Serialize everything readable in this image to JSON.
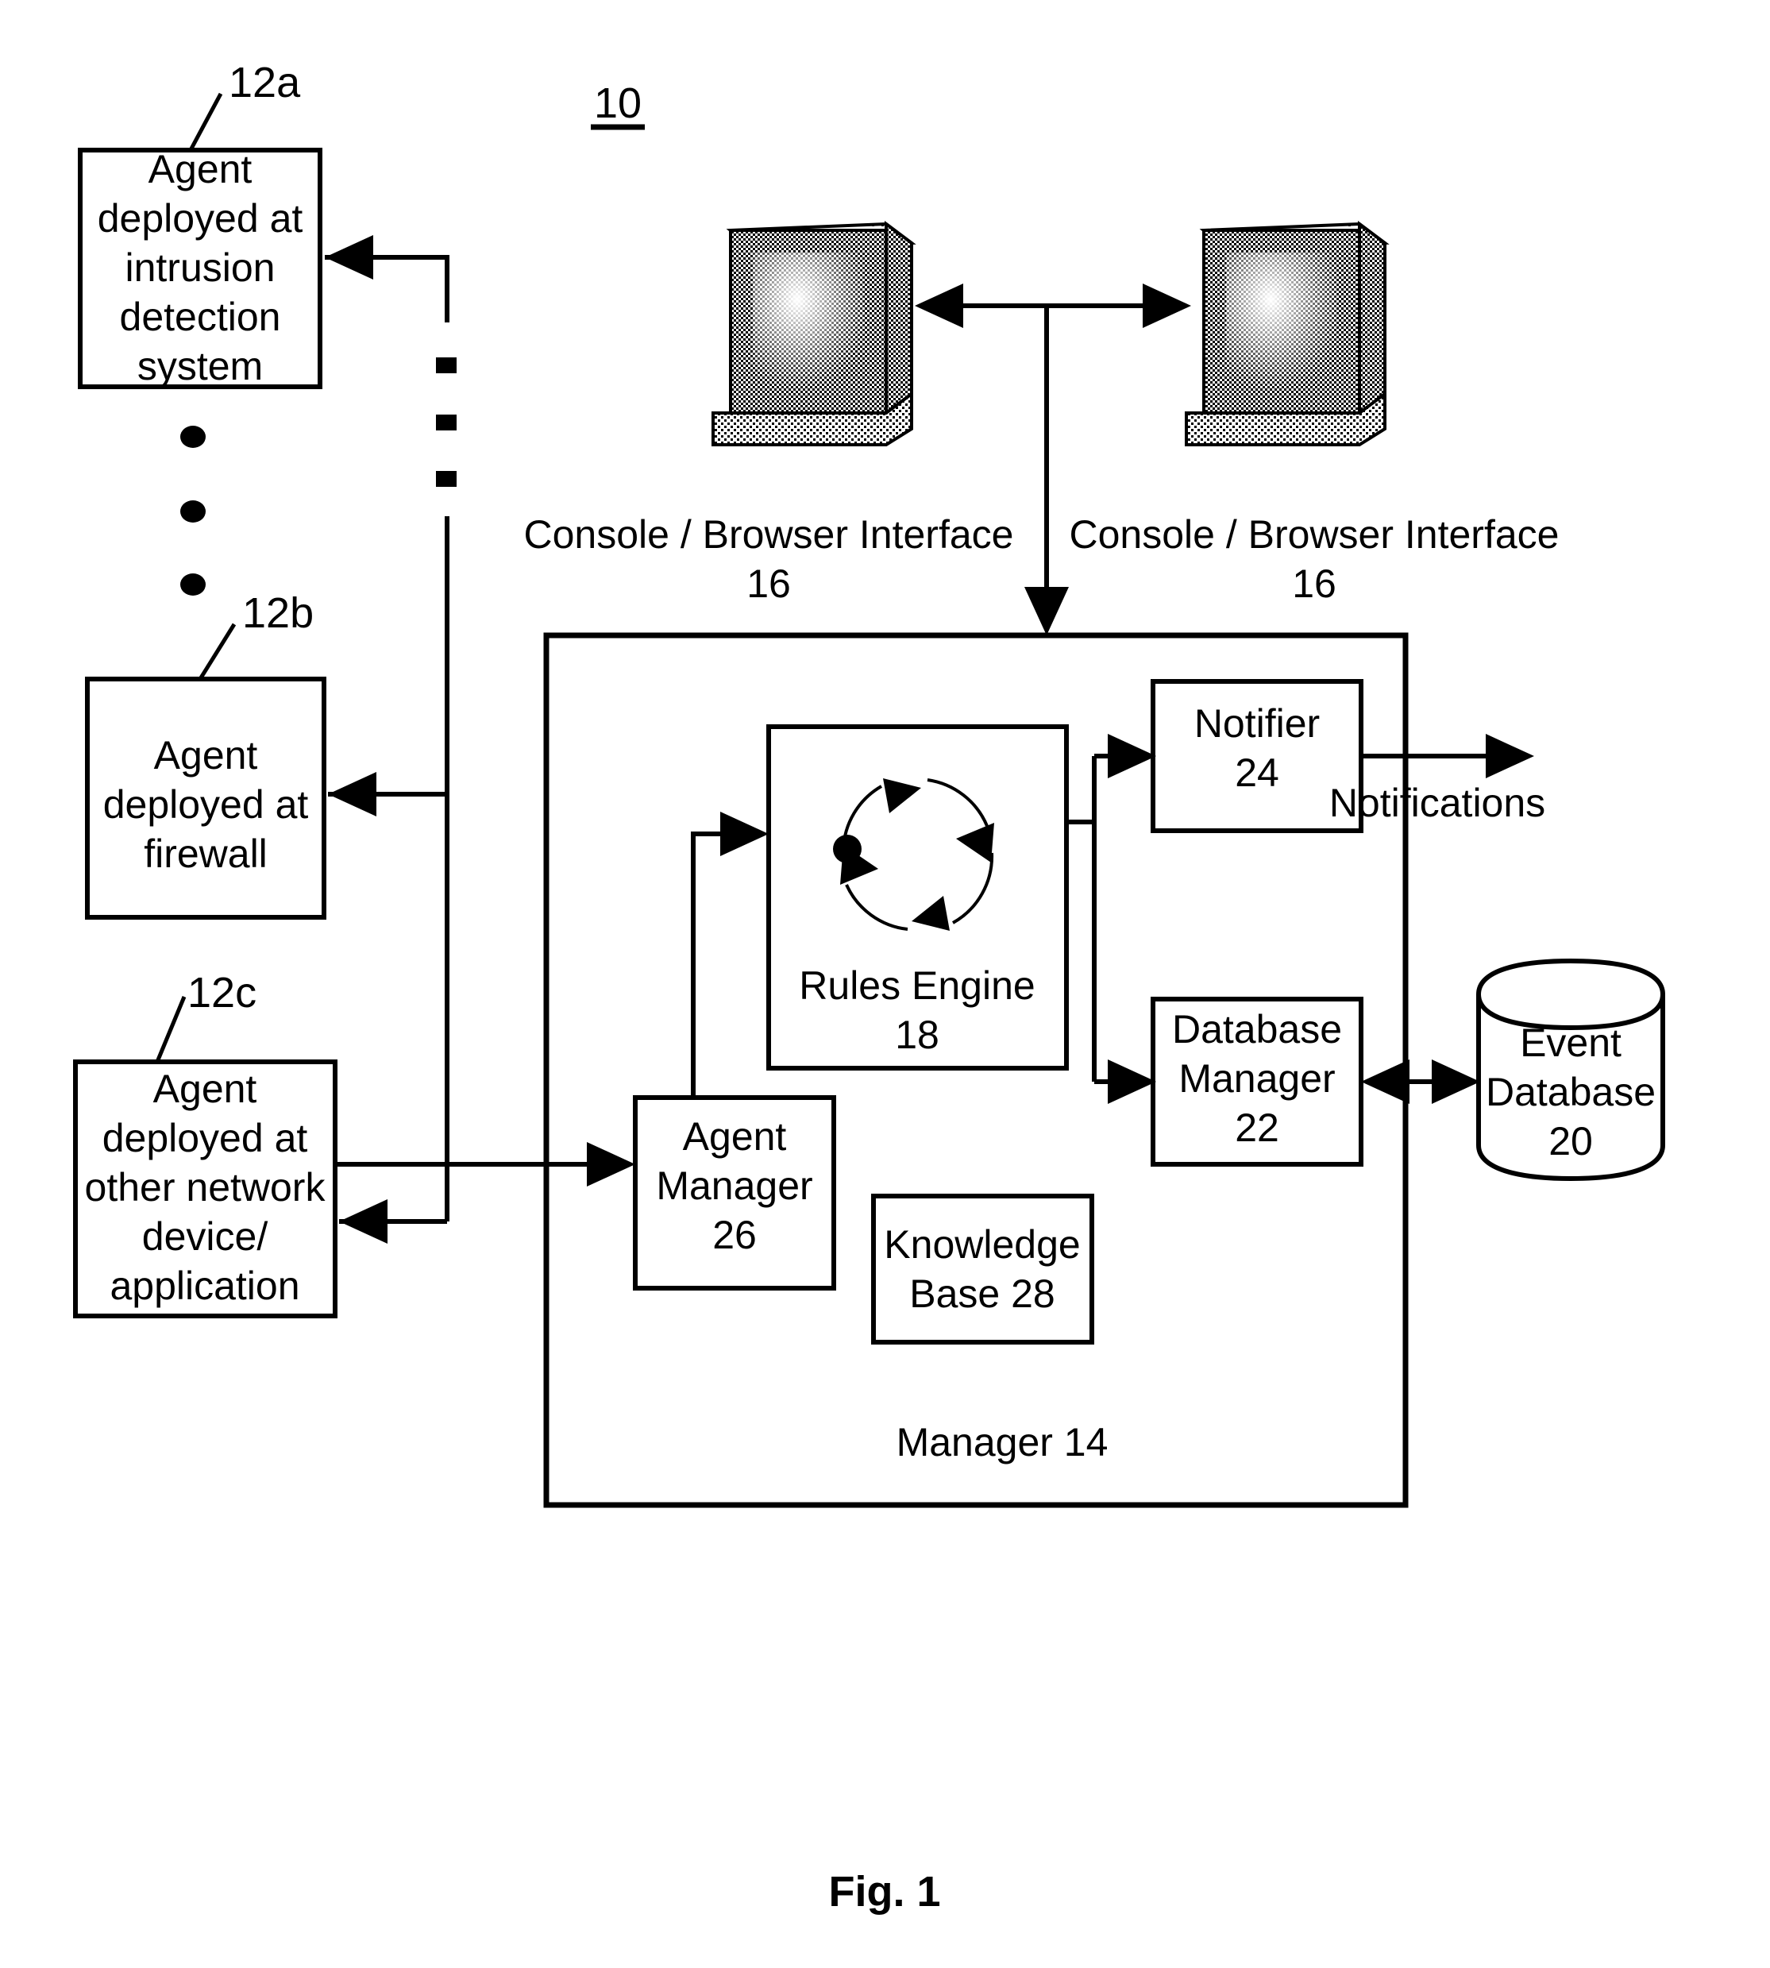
{
  "figure": {
    "system_ref": "10",
    "caption": "Fig. 1"
  },
  "agents": [
    {
      "ref": "12a",
      "lines": [
        "Agent",
        "deployed at",
        "intrusion",
        "detection",
        "system"
      ]
    },
    {
      "ref": "12b",
      "lines": [
        "Agent",
        "deployed at",
        "firewall"
      ]
    },
    {
      "ref": "12c",
      "lines": [
        "Agent",
        "deployed at",
        "other network",
        "device/",
        "application"
      ]
    }
  ],
  "consoles": [
    {
      "icon": "crt-monitor-icon",
      "label": "Console / Browser Interface",
      "ref": "16"
    },
    {
      "icon": "crt-monitor-icon",
      "label": "Console / Browser Interface",
      "ref": "16"
    }
  ],
  "manager": {
    "label": "Manager 14",
    "components": {
      "rules_engine": {
        "label": "Rules Engine",
        "ref": "18",
        "icon": "cycle-loop-icon"
      },
      "notifier": {
        "label": "Notifier",
        "ref": "24"
      },
      "database_manager": {
        "label_line1": "Database",
        "label_line2": "Manager",
        "ref": "22"
      },
      "agent_manager": {
        "label_line1": "Agent",
        "label_line2": "Manager",
        "ref": "26"
      },
      "knowledge_base": {
        "label_line1": "Knowledge",
        "label_line2": "Base 28"
      }
    }
  },
  "event_database": {
    "label_line1": "Event",
    "label_line2": "Database",
    "ref": "20",
    "shape": "cylinder"
  },
  "notifications": {
    "label": "Notifications"
  },
  "ellipsis": {
    "round_dots_count": 3,
    "square_dots_count": 3
  },
  "colors": {
    "stroke": "#000000",
    "background": "#ffffff"
  }
}
